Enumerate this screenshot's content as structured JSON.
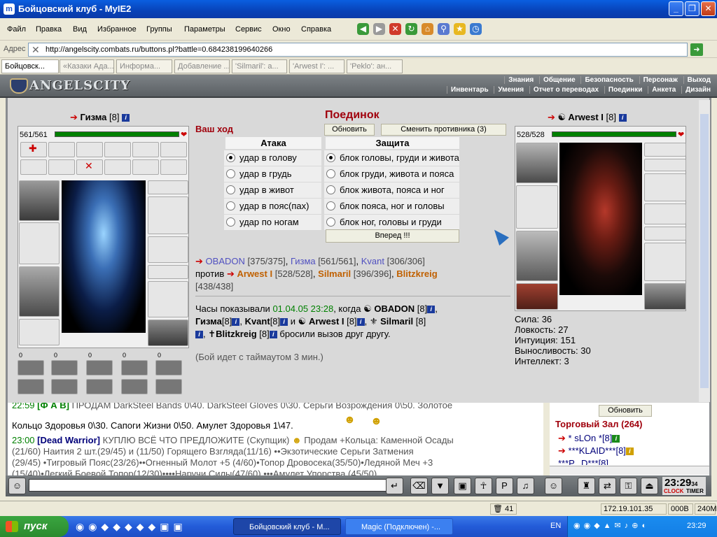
{
  "window": {
    "title": "Бойцовский клуб - MyIE2"
  },
  "menu": [
    "Файл",
    "Правка",
    "Вид",
    "Избранное",
    "Группы",
    "Параметры",
    "Сервис",
    "Окно",
    "Справка"
  ],
  "address": {
    "label": "Адрес",
    "url": "http://angelscity.combats.ru/buttons.pl?battle=0.684238199640266"
  },
  "tabs": [
    "Бойцовск...",
    "«Казаки Ада...",
    "Информа...",
    "Добавление ...",
    "'Silmaril': a...",
    "'Arwest I': ...",
    "'Peklo': ан..."
  ],
  "game_header": {
    "logo": "ANGELSCITY",
    "nav_top": [
      "Знания",
      "Общение",
      "Безопасность",
      "Персонаж",
      "Выход"
    ],
    "nav_bottom": [
      "Инвентарь",
      "Умения",
      "Отчет о переводах",
      "Поединки",
      "Анкета",
      "Дизайн"
    ]
  },
  "player": {
    "name": "Гизма",
    "level": "[8]",
    "hp": "561/561"
  },
  "enemy": {
    "name": "Arwest I",
    "level": "[8]",
    "hp": "528/528",
    "stats": [
      "Сила: 36",
      "Ловкость: 27",
      "Интуиция: 151",
      "Выносливость: 30",
      "Интеллект: 3"
    ]
  },
  "counters": [
    "0",
    "0",
    "0",
    "0",
    "0"
  ],
  "battle": {
    "title": "Поединок",
    "your_turn": "Ваш ход",
    "refresh": "Обновить",
    "change_opponent": "Сменить противника (3)",
    "attack_header": "Атака",
    "defense_header": "Защита",
    "attacks": [
      "удар в голову",
      "удар в грудь",
      "удар в живот",
      "удар в пояс(пах)",
      "удар по ногам"
    ],
    "defenses": [
      "блок головы, груди и живота",
      "блок груди, живота и пояса",
      "блок живота, пояса и ног",
      "блок пояса, ног и головы",
      "блок ног, головы и груди"
    ],
    "forward": "Вперед !!!"
  },
  "teams": {
    "team1": [
      {
        "name": "OBADON",
        "hp": "[375/375]"
      },
      {
        "name": "Гизма",
        "hp": "[561/561]"
      },
      {
        "name": "Kvant",
        "hp": "[306/306]"
      }
    ],
    "vs": "против",
    "team2": [
      {
        "name": "Arwest I",
        "hp": "[528/528]"
      },
      {
        "name": "Silmaril",
        "hp": "[396/396]"
      },
      {
        "name": "Blitzkreig",
        "hp": "[438/438]"
      }
    ]
  },
  "log": {
    "prefix": "Часы показывали",
    "datetime": "01.04.05 23:28",
    "when": ", когда",
    "line1_name": "OBADON",
    "line1_lv": "[8]",
    "line2": [
      {
        "name": "Гизма",
        "lv": "[8]"
      },
      {
        "name": "Kvant",
        "lv": "[8]"
      }
    ],
    "and": "и",
    "line2_name3": "Arwest I",
    "line2_lv3": "[8]",
    "line2_name4": "Silmaril",
    "line2_lv4": "[8]",
    "line3_name": "Blitzkreig",
    "line3_lv": "[8]",
    "line3_text": "бросили вызов друг другу.",
    "timeout": "(Бой идет с таймаутом 3 мин.)"
  },
  "chat": {
    "lines": [
      {
        "ts": "22:59",
        "nick": "[Ф А В]",
        "text": "ПРОДАМ DarkSteel Bands 0\\40. DarkSteel Gloves 0\\30. Серьги Возрождения 0\\50. Золотое"
      },
      {
        "ts": "",
        "nick": "",
        "text": "Кольцо Здоровья 0\\30. Сапоги Жизни 0\\50. Амулет Здоровья 1\\47."
      },
      {
        "ts": "23:00",
        "nick": "[Dead Warrior]",
        "text": "КУПЛЮ ВСЁ ЧТО ПРЕДЛОЖИТЕ (Скупщик)"
      },
      {
        "ts": "",
        "nick": "",
        "text": "(21/60) Наития 2 шт.(29/45) и (11/50) Горящего Взгляда(11/16) ••Экзотические Серьги Затмения"
      },
      {
        "ts": "",
        "nick": "",
        "text": "(29/45) •Тигровый Пояс(23/26)••Огненный Молот +5 (4/60)•Топор Дровосека(35/50)•Ледяной Меч +3"
      },
      {
        "ts": "",
        "nick": "",
        "text": "(15/40)•Легкий Боевой Топор(12/30)••••Наручи Силы(47/60) •••Амулет Упорства (45/50)"
      }
    ],
    "line3_tail": "Продам +Кольца: Каменной Осады"
  },
  "room": {
    "refresh": "Обновить",
    "title": "Торговый Зал (264)",
    "users": [
      "* sLOn *[8]",
      "***KLAID***[8]",
      "***P...D***[8]"
    ]
  },
  "clock": {
    "time": "23:29",
    "sec": "34",
    "label1": "CLOCK",
    "label2": "TIMER"
  },
  "statusbar": {
    "count": "41",
    "ip": "172.19.101.35",
    "bytes": "000B",
    "mem": "240M"
  },
  "taskbar": {
    "start": "пуск",
    "tasks": [
      "Бойцовский клуб - М...",
      "Magic (Подключен) -..."
    ],
    "lang": "EN",
    "time": "23:29"
  },
  "colors": {
    "hp_green": "#008000",
    "title_red": "#a0000c",
    "link_blue": "#5050c0",
    "team2_orange": "#c06000"
  }
}
